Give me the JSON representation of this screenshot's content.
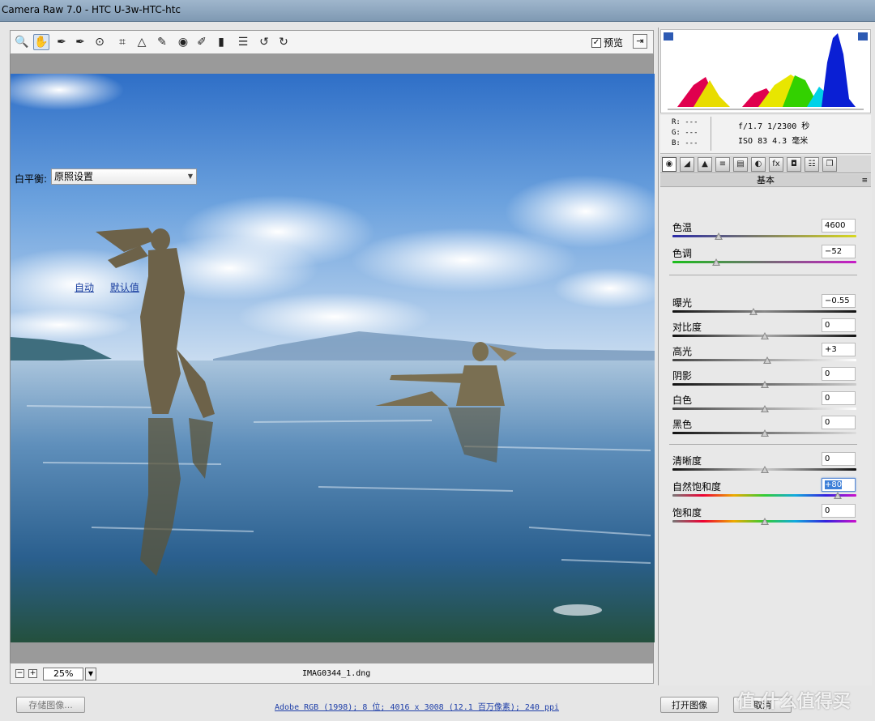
{
  "window": {
    "title": "Camera Raw 7.0 -  HTC U-3w-HTC-htc"
  },
  "toolbar": {
    "tools": [
      {
        "name": "zoom-tool-icon",
        "glyph": "🔍"
      },
      {
        "name": "hand-tool-icon",
        "glyph": "✋"
      },
      {
        "name": "white-balance-tool-icon",
        "glyph": "✒"
      },
      {
        "name": "color-sampler-tool-icon",
        "glyph": "✒"
      },
      {
        "name": "targeted-adjustment-tool-icon",
        "glyph": "⊙"
      },
      {
        "name": "crop-tool-icon",
        "glyph": "⌗"
      },
      {
        "name": "straighten-tool-icon",
        "glyph": "△"
      },
      {
        "name": "spot-removal-tool-icon",
        "glyph": "✎"
      },
      {
        "name": "red-eye-tool-icon",
        "glyph": "◉"
      },
      {
        "name": "adjustment-brush-icon",
        "glyph": "✐"
      },
      {
        "name": "graduated-filter-icon",
        "glyph": "▮"
      },
      {
        "name": "preferences-icon",
        "glyph": "☰"
      },
      {
        "name": "rotate-left-icon",
        "glyph": "↺"
      },
      {
        "name": "rotate-right-icon",
        "glyph": "↻"
      }
    ],
    "preview_label": "预览",
    "preview_checked": "✓",
    "fullscreen_glyph": "⇥"
  },
  "image_bar": {
    "zoom_minus": "−",
    "zoom_plus": "+",
    "zoom_value": "25%",
    "zoom_dropdown": "▼",
    "filename": "IMAG0344_1.dng"
  },
  "readout": {
    "r": "R:  ---",
    "g": "G:  ---",
    "b": "B:  ---",
    "line1": "f/1.7   1/2300 秒",
    "line2": "ISO 83   4.3 毫米"
  },
  "panel_tabs": [
    "◉",
    "◢",
    "▲",
    "≡",
    "▤",
    "◐",
    "fx",
    "◘",
    "☷",
    "❐"
  ],
  "panel": {
    "title": "基本",
    "menu": "≡",
    "white_balance_label": "白平衡:",
    "white_balance_value": "原照设置",
    "auto_link": "自动",
    "default_link": "默认值",
    "sliders": [
      {
        "label": "色温",
        "value": "4600",
        "pos": 0.25
      },
      {
        "label": "色调",
        "value": "−52",
        "pos": 0.24
      },
      {
        "label": "曝光",
        "value": "−0.55",
        "pos": 0.44
      },
      {
        "label": "对比度",
        "value": "0",
        "pos": 0.5
      },
      {
        "label": "高光",
        "value": "+3",
        "pos": 0.515
      },
      {
        "label": "阴影",
        "value": "0",
        "pos": 0.5
      },
      {
        "label": "白色",
        "value": "0",
        "pos": 0.5
      },
      {
        "label": "黑色",
        "value": "0",
        "pos": 0.5
      },
      {
        "label": "清晰度",
        "value": "0",
        "pos": 0.5
      },
      {
        "label": "自然饱和度",
        "value": "+80",
        "pos": 0.9
      },
      {
        "label": "饱和度",
        "value": "0",
        "pos": 0.5
      }
    ]
  },
  "footer": {
    "save_label": "存储图像...",
    "workflow_text": "Adobe RGB (1998); 8 位; 4016 x 3008 (12.1 百万像素); 240 ppi",
    "open_label": "打开图像",
    "cancel_label": "取消",
    "watermark": "值 什么值得买"
  }
}
